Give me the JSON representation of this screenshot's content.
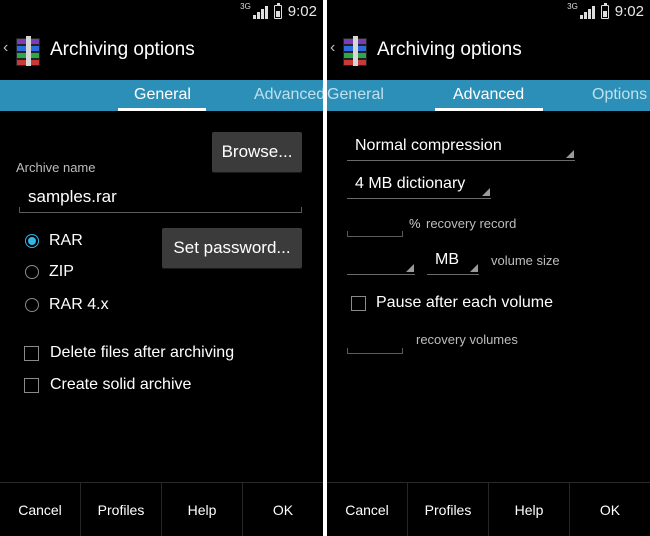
{
  "status": {
    "network": "3G",
    "time": "9:02"
  },
  "left": {
    "title": "Archiving options",
    "tabs": [
      "General",
      "Advanced"
    ],
    "archive_name_label": "Archive name",
    "archive_name_value": "samples.rar",
    "browse_label": "Browse...",
    "set_password_label": "Set password...",
    "formats": [
      {
        "label": "RAR",
        "selected": true
      },
      {
        "label": "ZIP",
        "selected": false
      },
      {
        "label": "RAR 4.x",
        "selected": false
      }
    ],
    "options": [
      {
        "label": "Delete files after archiving",
        "checked": false
      },
      {
        "label": "Create solid archive",
        "checked": false
      }
    ],
    "buttons": [
      "Cancel",
      "Profiles",
      "Help",
      "OK"
    ]
  },
  "right": {
    "title": "Archiving options",
    "tabs": [
      "General",
      "Advanced",
      "Options"
    ],
    "compression_value": "Normal compression",
    "dictionary_value": "4 MB dictionary",
    "recovery_percent_symbol": "%",
    "recovery_record_label": "recovery record",
    "volume_unit_value": "MB",
    "volume_size_label": "volume size",
    "pause_label": "Pause after each volume",
    "pause_checked": false,
    "recovery_volumes_label": "recovery volumes",
    "buttons": [
      "Cancel",
      "Profiles",
      "Help",
      "OK"
    ]
  },
  "colors": {
    "accent_bar": "#2c8fb7",
    "selection": "#33b5e5"
  },
  "icons": [
    "winrar-app-icon",
    "back-caret-icon",
    "signal-icon",
    "battery-icon"
  ]
}
